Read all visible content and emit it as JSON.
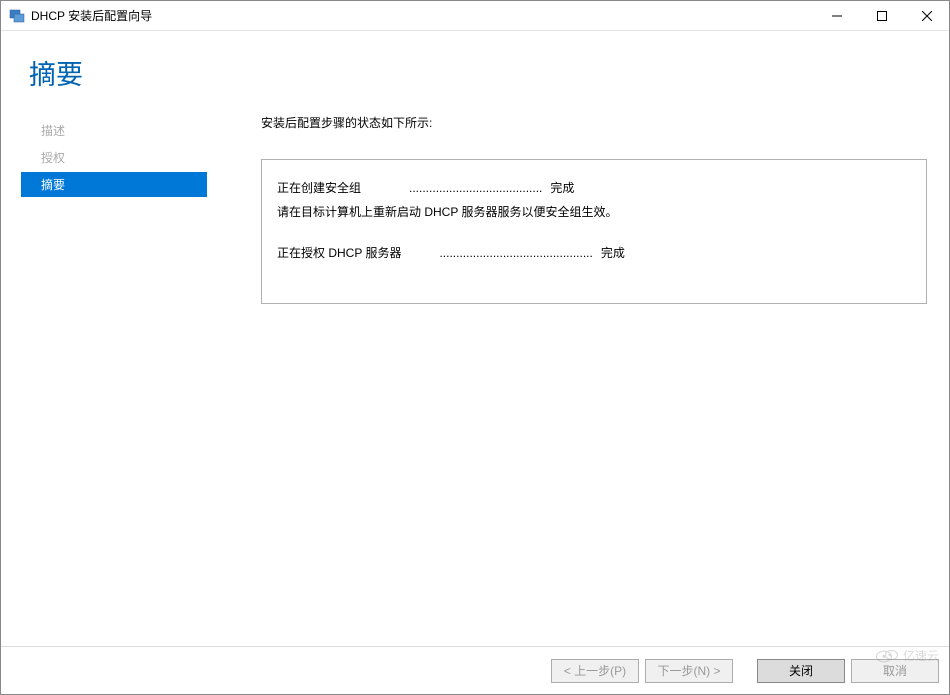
{
  "window": {
    "title": "DHCP 安装后配置向导"
  },
  "header": {
    "title": "摘要"
  },
  "sidebar": {
    "items": [
      {
        "label": "描述"
      },
      {
        "label": "授权"
      },
      {
        "label": "摘要"
      }
    ]
  },
  "main": {
    "intro": "安装后配置步骤的状态如下所示:",
    "status": {
      "line1_label": "正在创建安全组",
      "line1_dots": "........................................",
      "line1_result": "完成",
      "line2": "请在目标计算机上重新启动 DHCP 服务器服务以便安全组生效。",
      "line3_label": "正在授权 DHCP 服务器",
      "line3_dots": "..............................................",
      "line3_result": "完成"
    }
  },
  "buttons": {
    "prev": "< 上一步(P)",
    "next": "下一步(N) >",
    "close": "关闭",
    "cancel": "取消"
  },
  "watermark": {
    "text": "亿速云"
  }
}
